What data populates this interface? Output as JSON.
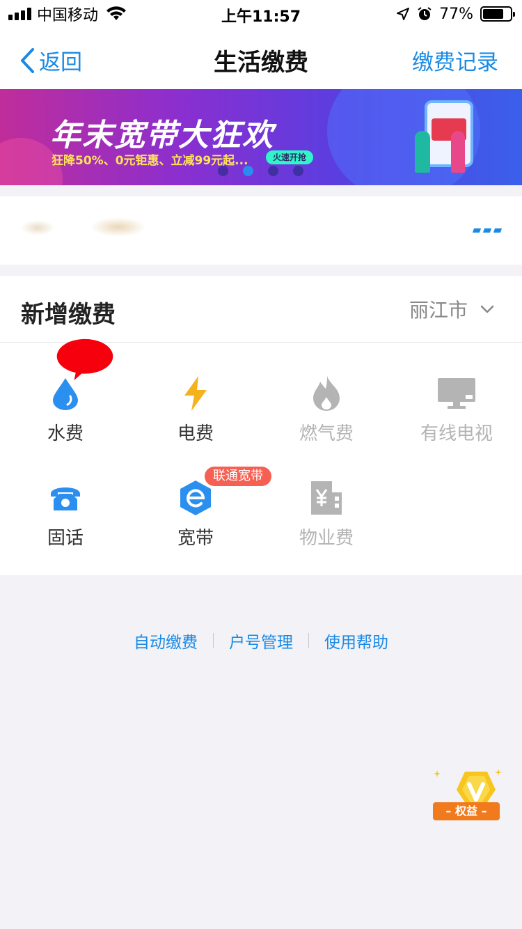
{
  "status_bar": {
    "carrier": "中国移动",
    "time": "上午11:57",
    "battery_percent": "77%",
    "battery_level": 0.77
  },
  "nav": {
    "back_label": "返回",
    "title": "生活缴费",
    "action_label": "缴费记录"
  },
  "banner": {
    "title": "年末宽带大狂欢",
    "subtitle": "狂降50%、0元钜惠、立减99元起...",
    "cta": "火速开抢",
    "slide_count": 4,
    "active_slide": 2
  },
  "section": {
    "title": "新增缴费",
    "city": "丽江市"
  },
  "services": [
    {
      "label": "水费",
      "icon": "water-drop-icon",
      "enabled": true
    },
    {
      "label": "电费",
      "icon": "lightning-icon",
      "enabled": true
    },
    {
      "label": "燃气费",
      "icon": "flame-icon",
      "enabled": false
    },
    {
      "label": "有线电视",
      "icon": "tv-icon",
      "enabled": false
    },
    {
      "label": "固话",
      "icon": "telephone-icon",
      "enabled": true
    },
    {
      "label": "宽带",
      "icon": "broadband-icon",
      "enabled": true
    },
    {
      "label": "物业费",
      "icon": "building-icon",
      "enabled": false
    }
  ],
  "broadband_tag": "联通宽带",
  "footer_links": [
    "自动缴费",
    "户号管理",
    "使用帮助"
  ],
  "rights_badge": "权益",
  "colors": {
    "accent": "#1a8ae5",
    "tag": "#f66052",
    "lightning": "#f5b21c",
    "disabled": "#b4b4b4",
    "badge": "#f07a1c"
  }
}
